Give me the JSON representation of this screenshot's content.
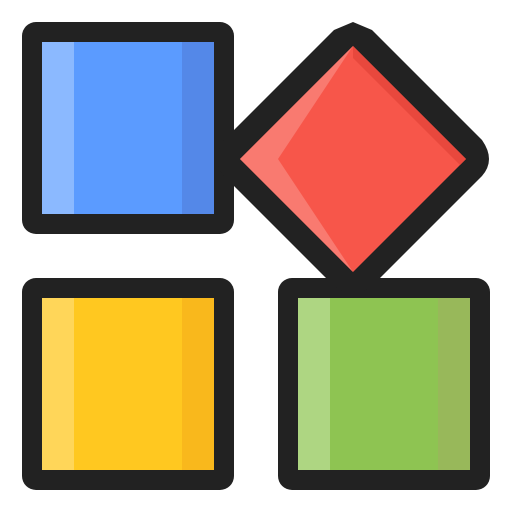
{
  "icon": {
    "name": "apps-grid-icon",
    "colors": {
      "outline": "#222222",
      "blue_base": "#5b9bff",
      "blue_light": "#8bb9ff",
      "blue_dark": "#5488e8",
      "red_base": "#f7564a",
      "red_light": "#f97a70",
      "red_dark": "#e8483d",
      "yellow_base": "#ffc820",
      "yellow_light": "#ffd659",
      "yellow_dark": "#f9b81c",
      "green_base": "#8ec452",
      "green_light": "#aed682",
      "green_dark": "#98b85a"
    }
  }
}
